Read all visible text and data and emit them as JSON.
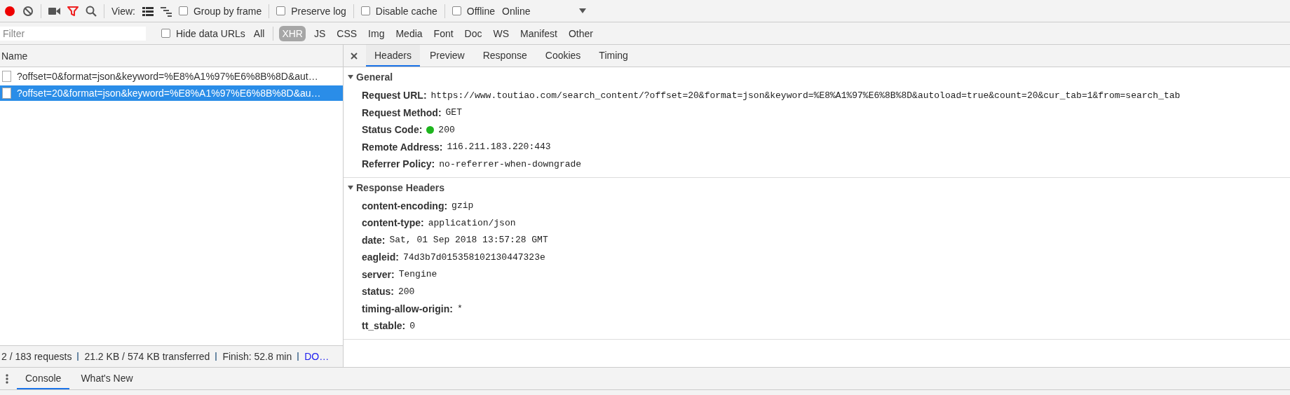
{
  "toolbar": {
    "recording": true,
    "filter_on": true,
    "view_label": "View:",
    "view_modes": [
      {
        "kind": "list",
        "selected": true
      },
      {
        "kind": "waterfall",
        "selected": false
      }
    ],
    "checkboxes": [
      {
        "label": "Group by frame",
        "checked": false
      },
      {
        "label": "Preserve log",
        "checked": false
      },
      {
        "label": "Disable cache",
        "checked": false
      },
      {
        "label": "Offline",
        "checked": false
      }
    ],
    "throttling": "Online"
  },
  "filter_bar": {
    "placeholder": "Filter",
    "hide_data_urls": {
      "label": "Hide data URLs",
      "checked": false
    },
    "types": [
      {
        "label": "All",
        "selected": false
      },
      {
        "label": "XHR",
        "selected": true
      },
      {
        "label": "JS",
        "selected": false
      },
      {
        "label": "CSS",
        "selected": false
      },
      {
        "label": "Img",
        "selected": false
      },
      {
        "label": "Media",
        "selected": false
      },
      {
        "label": "Font",
        "selected": false
      },
      {
        "label": "Doc",
        "selected": false
      },
      {
        "label": "WS",
        "selected": false
      },
      {
        "label": "Manifest",
        "selected": false
      },
      {
        "label": "Other",
        "selected": false
      }
    ]
  },
  "requests": {
    "column": "Name",
    "rows": [
      {
        "name": "?offset=0&format=json&keyword=%E8%A1%97%E6%8B%8D&aut…",
        "selected": false
      },
      {
        "name": "?offset=20&format=json&keyword=%E8%A1%97%E6%8B%8D&au…",
        "selected": true
      }
    ]
  },
  "status_bar": {
    "items": [
      "2 / 183 requests",
      "21.2 KB / 574 KB transferred",
      "Finish: 52.8 min"
    ],
    "link": "DO…"
  },
  "details": {
    "tabs": [
      {
        "label": "Headers",
        "selected": true
      },
      {
        "label": "Preview",
        "selected": false
      },
      {
        "label": "Response",
        "selected": false
      },
      {
        "label": "Cookies",
        "selected": false
      },
      {
        "label": "Timing",
        "selected": false
      }
    ],
    "sections": [
      {
        "title": "General",
        "expanded": true,
        "rows": [
          {
            "kind": "plain",
            "key": "Request URL:",
            "value": "https://www.toutiao.com/search_content/?offset=20&format=json&keyword=%E8%A1%97%E6%8B%8D&autoload=true&count=20&cur_tab=1&from=search_tab"
          },
          {
            "kind": "plain",
            "key": "Request Method:",
            "value": "GET"
          },
          {
            "kind": "status",
            "key": "Status Code:",
            "value": "200"
          },
          {
            "kind": "plain",
            "key": "Remote Address:",
            "value": "116.211.183.220:443"
          },
          {
            "kind": "plain",
            "key": "Referrer Policy:",
            "value": "no-referrer-when-downgrade"
          }
        ]
      },
      {
        "title": "Response Headers",
        "expanded": true,
        "rows": [
          {
            "kind": "plain",
            "key": "content-encoding:",
            "value": "gzip"
          },
          {
            "kind": "plain",
            "key": "content-type:",
            "value": "application/json"
          },
          {
            "kind": "plain",
            "key": "date:",
            "value": "Sat, 01 Sep 2018 13:57:28 GMT"
          },
          {
            "kind": "plain",
            "key": "eagleid:",
            "value": "74d3b7d015358102130447323e"
          },
          {
            "kind": "plain",
            "key": "server:",
            "value": "Tengine"
          },
          {
            "kind": "plain",
            "key": "status:",
            "value": "200"
          },
          {
            "kind": "plain",
            "key": "timing-allow-origin:",
            "value": "*"
          },
          {
            "kind": "plain",
            "key": "tt_stable:",
            "value": "0"
          }
        ]
      }
    ]
  },
  "drawer": {
    "tabs": [
      {
        "label": "Console",
        "selected": true
      },
      {
        "label": "What's New",
        "selected": false
      }
    ]
  }
}
